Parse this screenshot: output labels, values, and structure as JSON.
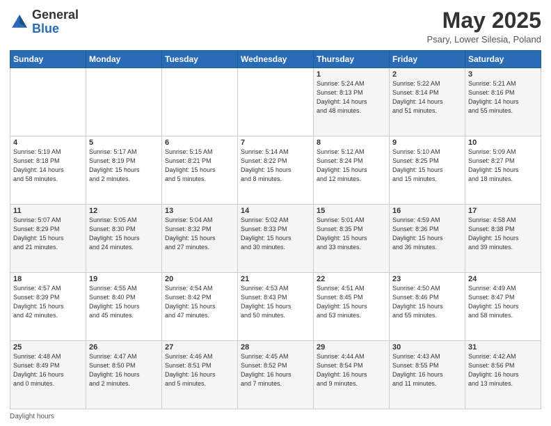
{
  "header": {
    "logo_general": "General",
    "logo_blue": "Blue",
    "month_title": "May 2025",
    "subtitle": "Psary, Lower Silesia, Poland"
  },
  "days_of_week": [
    "Sunday",
    "Monday",
    "Tuesday",
    "Wednesday",
    "Thursday",
    "Friday",
    "Saturday"
  ],
  "footer_text": "Daylight hours",
  "weeks": [
    [
      {
        "num": "",
        "info": ""
      },
      {
        "num": "",
        "info": ""
      },
      {
        "num": "",
        "info": ""
      },
      {
        "num": "",
        "info": ""
      },
      {
        "num": "1",
        "info": "Sunrise: 5:24 AM\nSunset: 8:13 PM\nDaylight: 14 hours\nand 48 minutes."
      },
      {
        "num": "2",
        "info": "Sunrise: 5:22 AM\nSunset: 8:14 PM\nDaylight: 14 hours\nand 51 minutes."
      },
      {
        "num": "3",
        "info": "Sunrise: 5:21 AM\nSunset: 8:16 PM\nDaylight: 14 hours\nand 55 minutes."
      }
    ],
    [
      {
        "num": "4",
        "info": "Sunrise: 5:19 AM\nSunset: 8:18 PM\nDaylight: 14 hours\nand 58 minutes."
      },
      {
        "num": "5",
        "info": "Sunrise: 5:17 AM\nSunset: 8:19 PM\nDaylight: 15 hours\nand 2 minutes."
      },
      {
        "num": "6",
        "info": "Sunrise: 5:15 AM\nSunset: 8:21 PM\nDaylight: 15 hours\nand 5 minutes."
      },
      {
        "num": "7",
        "info": "Sunrise: 5:14 AM\nSunset: 8:22 PM\nDaylight: 15 hours\nand 8 minutes."
      },
      {
        "num": "8",
        "info": "Sunrise: 5:12 AM\nSunset: 8:24 PM\nDaylight: 15 hours\nand 12 minutes."
      },
      {
        "num": "9",
        "info": "Sunrise: 5:10 AM\nSunset: 8:25 PM\nDaylight: 15 hours\nand 15 minutes."
      },
      {
        "num": "10",
        "info": "Sunrise: 5:09 AM\nSunset: 8:27 PM\nDaylight: 15 hours\nand 18 minutes."
      }
    ],
    [
      {
        "num": "11",
        "info": "Sunrise: 5:07 AM\nSunset: 8:29 PM\nDaylight: 15 hours\nand 21 minutes."
      },
      {
        "num": "12",
        "info": "Sunrise: 5:05 AM\nSunset: 8:30 PM\nDaylight: 15 hours\nand 24 minutes."
      },
      {
        "num": "13",
        "info": "Sunrise: 5:04 AM\nSunset: 8:32 PM\nDaylight: 15 hours\nand 27 minutes."
      },
      {
        "num": "14",
        "info": "Sunrise: 5:02 AM\nSunset: 8:33 PM\nDaylight: 15 hours\nand 30 minutes."
      },
      {
        "num": "15",
        "info": "Sunrise: 5:01 AM\nSunset: 8:35 PM\nDaylight: 15 hours\nand 33 minutes."
      },
      {
        "num": "16",
        "info": "Sunrise: 4:59 AM\nSunset: 8:36 PM\nDaylight: 15 hours\nand 36 minutes."
      },
      {
        "num": "17",
        "info": "Sunrise: 4:58 AM\nSunset: 8:38 PM\nDaylight: 15 hours\nand 39 minutes."
      }
    ],
    [
      {
        "num": "18",
        "info": "Sunrise: 4:57 AM\nSunset: 8:39 PM\nDaylight: 15 hours\nand 42 minutes."
      },
      {
        "num": "19",
        "info": "Sunrise: 4:55 AM\nSunset: 8:40 PM\nDaylight: 15 hours\nand 45 minutes."
      },
      {
        "num": "20",
        "info": "Sunrise: 4:54 AM\nSunset: 8:42 PM\nDaylight: 15 hours\nand 47 minutes."
      },
      {
        "num": "21",
        "info": "Sunrise: 4:53 AM\nSunset: 8:43 PM\nDaylight: 15 hours\nand 50 minutes."
      },
      {
        "num": "22",
        "info": "Sunrise: 4:51 AM\nSunset: 8:45 PM\nDaylight: 15 hours\nand 53 minutes."
      },
      {
        "num": "23",
        "info": "Sunrise: 4:50 AM\nSunset: 8:46 PM\nDaylight: 15 hours\nand 55 minutes."
      },
      {
        "num": "24",
        "info": "Sunrise: 4:49 AM\nSunset: 8:47 PM\nDaylight: 15 hours\nand 58 minutes."
      }
    ],
    [
      {
        "num": "25",
        "info": "Sunrise: 4:48 AM\nSunset: 8:49 PM\nDaylight: 16 hours\nand 0 minutes."
      },
      {
        "num": "26",
        "info": "Sunrise: 4:47 AM\nSunset: 8:50 PM\nDaylight: 16 hours\nand 2 minutes."
      },
      {
        "num": "27",
        "info": "Sunrise: 4:46 AM\nSunset: 8:51 PM\nDaylight: 16 hours\nand 5 minutes."
      },
      {
        "num": "28",
        "info": "Sunrise: 4:45 AM\nSunset: 8:52 PM\nDaylight: 16 hours\nand 7 minutes."
      },
      {
        "num": "29",
        "info": "Sunrise: 4:44 AM\nSunset: 8:54 PM\nDaylight: 16 hours\nand 9 minutes."
      },
      {
        "num": "30",
        "info": "Sunrise: 4:43 AM\nSunset: 8:55 PM\nDaylight: 16 hours\nand 11 minutes."
      },
      {
        "num": "31",
        "info": "Sunrise: 4:42 AM\nSunset: 8:56 PM\nDaylight: 16 hours\nand 13 minutes."
      }
    ]
  ]
}
